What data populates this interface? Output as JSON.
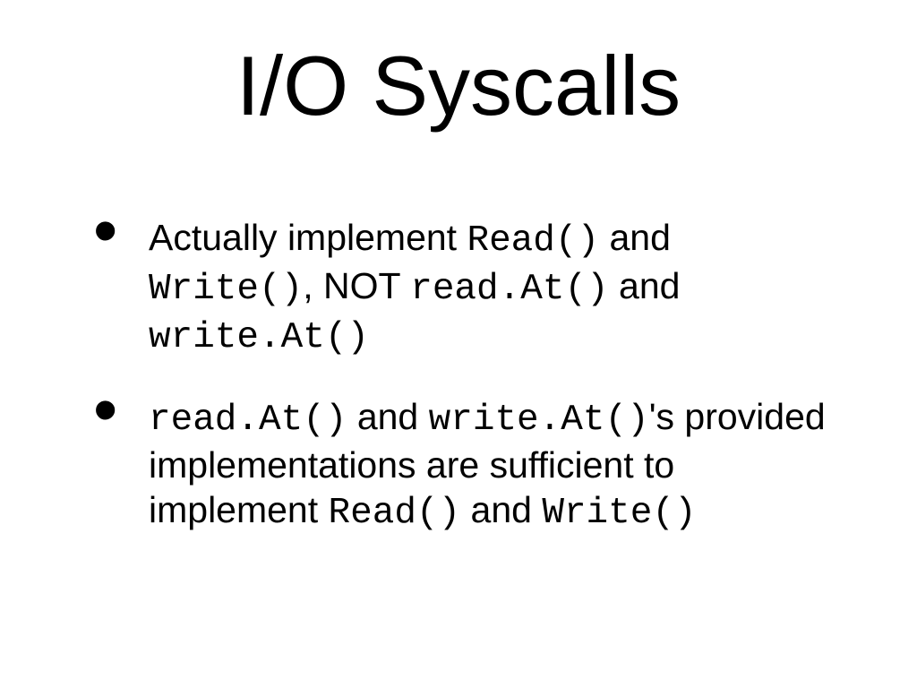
{
  "slide": {
    "title": "I/O Syscalls",
    "bullets": [
      {
        "t1": "Actually implement ",
        "c1": "Read()",
        "t2": " and ",
        "c2": "Write()",
        "t3": ", NOT ",
        "c3": "read.At()",
        "t4": " and ",
        "c4": "write.At()"
      },
      {
        "c1": "read.At()",
        "t1": " and ",
        "c2": "write.At()",
        "t2": "'s  provided implementations are sufficient to implement ",
        "c3": "Read()",
        "t3": " and ",
        "c4": "Write()"
      }
    ]
  }
}
